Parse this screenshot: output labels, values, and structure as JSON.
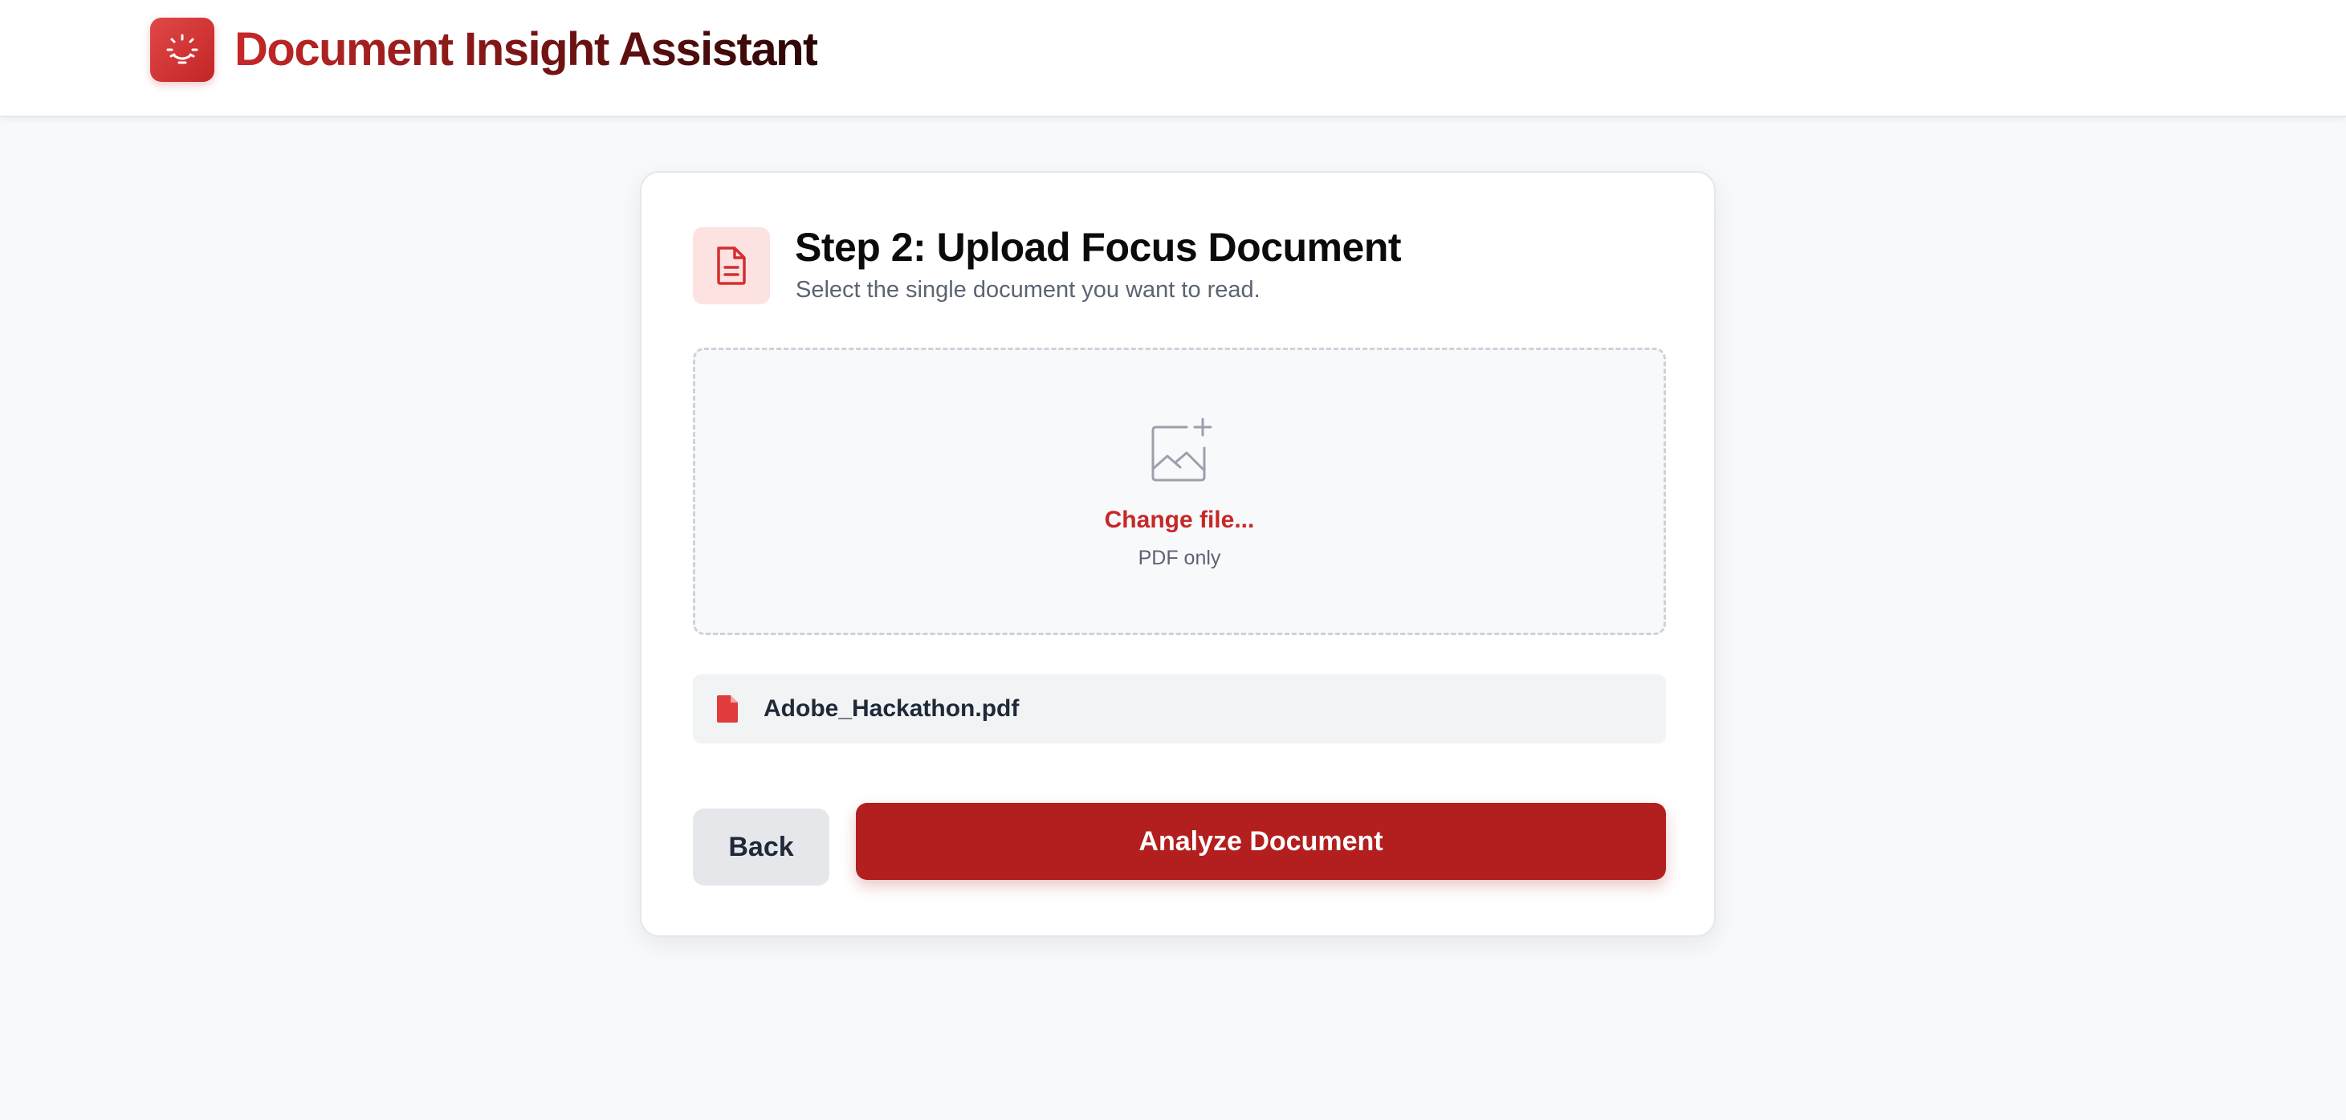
{
  "header": {
    "app_title": "Document Insight Assistant",
    "logo_icon": "lightbulb-icon"
  },
  "card": {
    "step_icon": "document-icon",
    "step_title": "Step 2: Upload Focus Document",
    "step_subtitle": "Select the single document you want to read.",
    "dropzone": {
      "icon": "image-plus-icon",
      "action_label": "Change file...",
      "hint": "PDF only"
    },
    "selected_file": {
      "icon": "pdf-file-icon",
      "name": "Adobe_Hackathon.pdf"
    },
    "buttons": {
      "back_label": "Back",
      "analyze_label": "Analyze Document"
    }
  },
  "colors": {
    "accent": "#c62828",
    "primary_button": "#b31e1e",
    "secondary_button": "#e5e7eb",
    "step_icon_bg": "#fde2e2"
  }
}
